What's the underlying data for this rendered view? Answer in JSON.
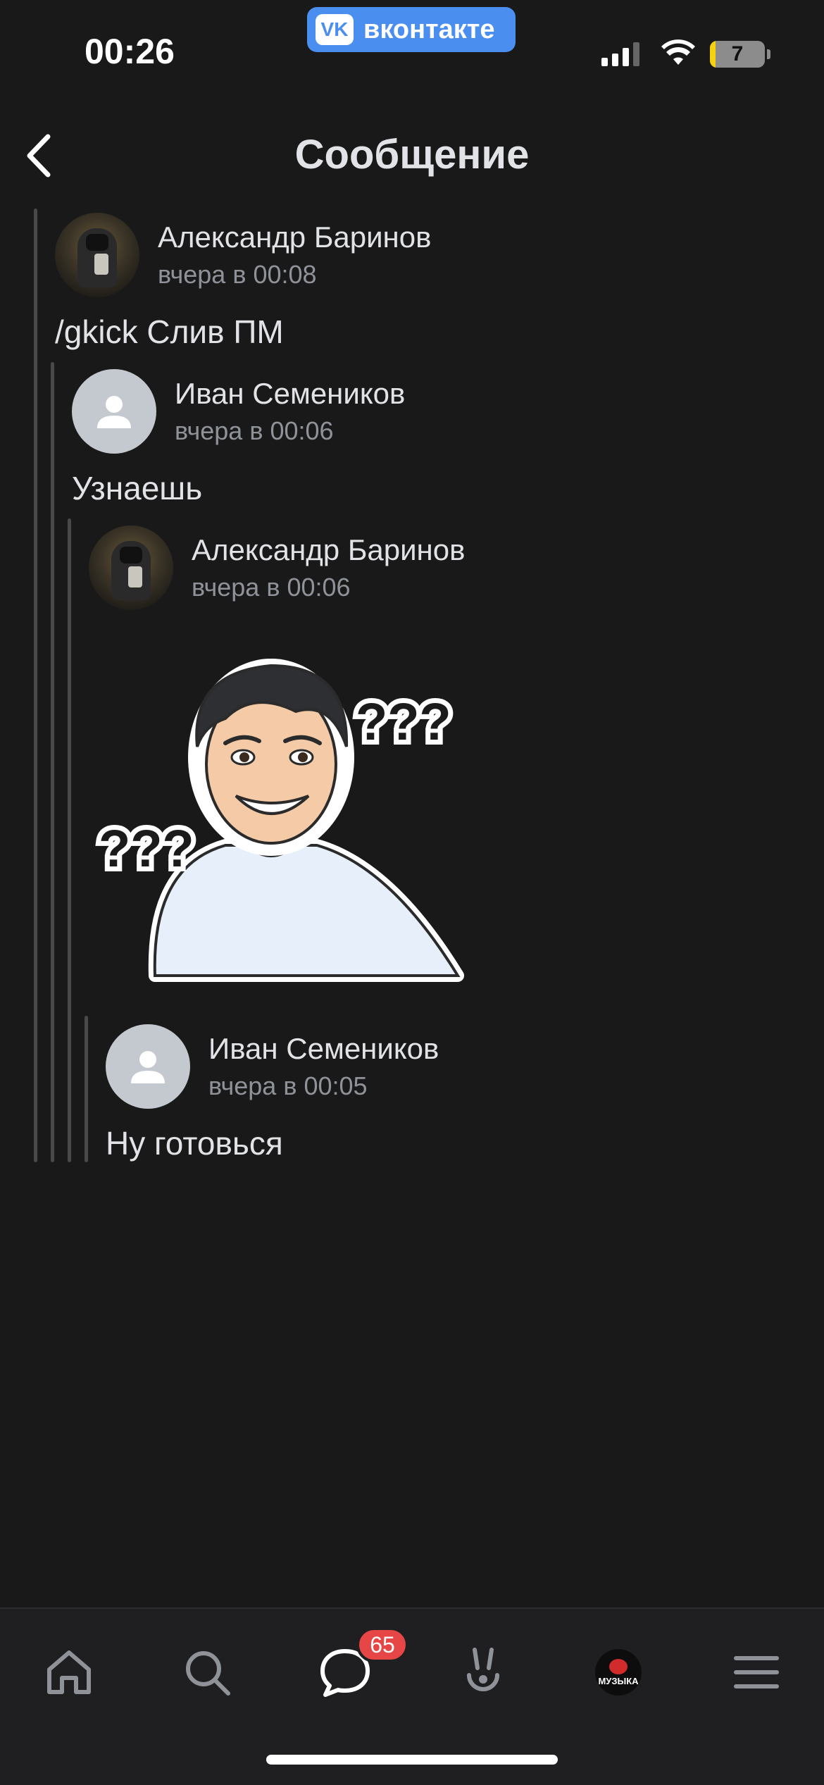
{
  "status_bar": {
    "time": "00:26",
    "battery": "7"
  },
  "source_app": {
    "logo": "VK",
    "label": "вконтакте"
  },
  "header": {
    "title": "Сообщение"
  },
  "messages": [
    {
      "author": "Александр Баринов",
      "time": "вчера в 00:08",
      "text": "/gkick Слив ПМ"
    },
    {
      "author": "Иван Семеников",
      "time": "вчера в 00:06",
      "text": "Узнаешь"
    },
    {
      "author": "Александр Баринов",
      "time": "вчера в 00:06",
      "sticker": "man-with-question-marks-sticker"
    },
    {
      "author": "Иван Семеников",
      "time": "вчера в 00:05",
      "text": "Ну готовься"
    }
  ],
  "sticker_text": {
    "left": "???",
    "right": "???"
  },
  "tabbar": {
    "items": [
      "home-icon",
      "search-icon",
      "messages-icon",
      "clips-icon",
      "music-icon",
      "menu-icon"
    ],
    "messages_badge": "65",
    "music_label": "МУЗЫКА"
  },
  "colors": {
    "background": "#19191a",
    "accent": "#4a8ef0",
    "badge": "#e64646"
  }
}
